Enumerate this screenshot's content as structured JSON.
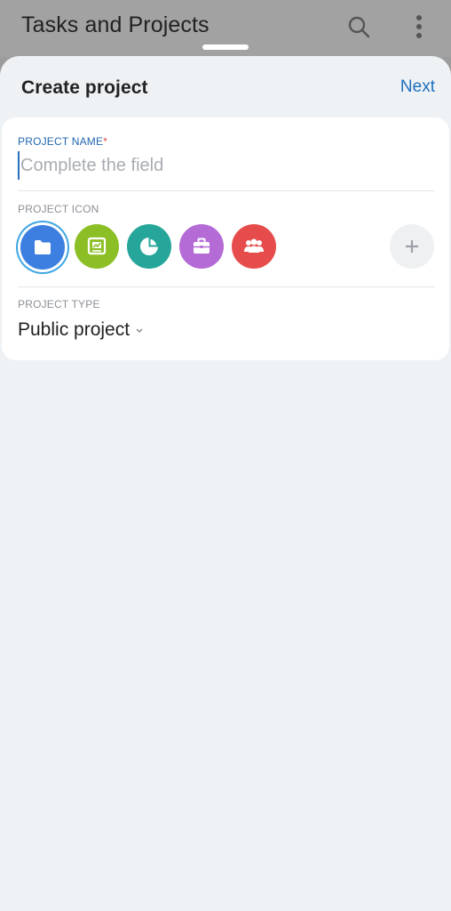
{
  "app_bar": {
    "title": "Tasks and Projects",
    "search_icon": "search-icon",
    "more_icon": "more-vert-icon"
  },
  "sheet": {
    "title": "Create project",
    "next_label": "Next"
  },
  "form": {
    "name_label": "PROJECT NAME",
    "name_required_mark": "*",
    "name_placeholder": "Complete the field",
    "name_value": "",
    "icon_label": "PROJECT ICON",
    "icons": [
      {
        "name": "folder-icon",
        "color": "#3d7fe0",
        "selected": true
      },
      {
        "name": "presentation-icon",
        "color": "#8cbf26"
      },
      {
        "name": "pie-chart-icon",
        "color": "#26a69a"
      },
      {
        "name": "briefcase-icon",
        "color": "#b56bd6"
      },
      {
        "name": "team-icon",
        "color": "#e64c4c"
      }
    ],
    "add_icon": "plus-icon",
    "type_label": "PROJECT TYPE",
    "type_value": "Public project"
  },
  "colors": {
    "accent": "#1e6fbf",
    "required": "#e04848",
    "sheet_bg": "#eef2f5",
    "scrim": "#a2a2a2"
  }
}
